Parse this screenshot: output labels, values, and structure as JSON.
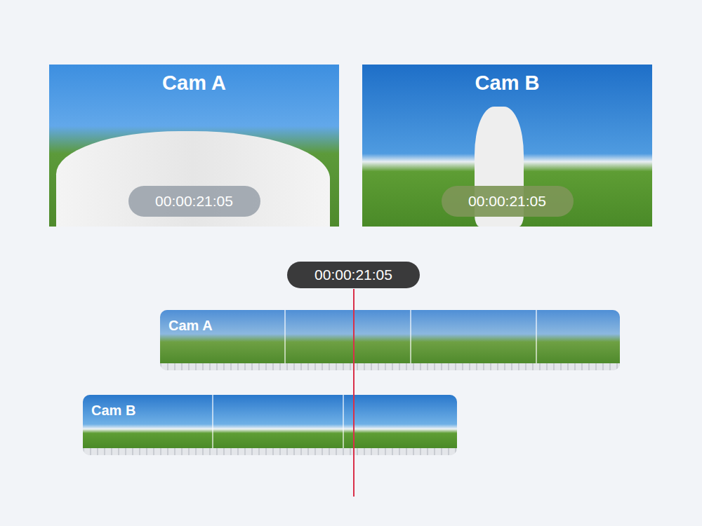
{
  "previews": [
    {
      "label": "Cam A",
      "timecode": "00:00:21:05"
    },
    {
      "label": "Cam B",
      "timecode": "00:00:21:05"
    }
  ],
  "playhead": {
    "timecode": "00:00:21:05"
  },
  "tracks": [
    {
      "label": "Cam A"
    },
    {
      "label": "Cam B"
    }
  ]
}
